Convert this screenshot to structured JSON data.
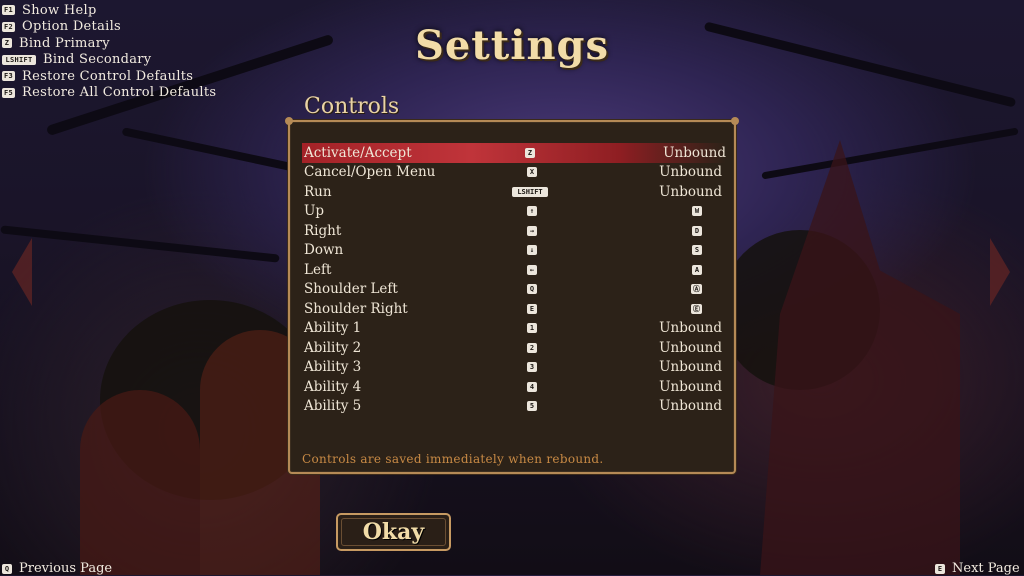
{
  "help": {
    "items": [
      {
        "key": "F1",
        "label": "Show Help"
      },
      {
        "key": "F2",
        "label": "Option Details"
      },
      {
        "key": "Z",
        "label": "Bind Primary"
      },
      {
        "key": "LSHIFT",
        "label": "Bind Secondary"
      },
      {
        "key": "F3",
        "label": "Restore Control Defaults"
      },
      {
        "key": "F5",
        "label": "Restore All Control Defaults"
      }
    ]
  },
  "header": {
    "title": "Settings",
    "section": "Controls"
  },
  "controls": [
    {
      "name": "Activate/Accept",
      "primary": "Z",
      "secondary": "Unbound",
      "selected": true
    },
    {
      "name": "Cancel/Open Menu",
      "primary": "X",
      "secondary": "Unbound"
    },
    {
      "name": "Run",
      "primary": "LSHIFT",
      "secondary": "Unbound"
    },
    {
      "name": "Up",
      "primary": "↑",
      "secondary_key": "W"
    },
    {
      "name": "Right",
      "primary": "→",
      "secondary_key": "D"
    },
    {
      "name": "Down",
      "primary": "↓",
      "secondary_key": "S"
    },
    {
      "name": "Left",
      "primary": "←",
      "secondary_key": "A"
    },
    {
      "name": "Shoulder Left",
      "primary": "Q",
      "secondary_key": "Ⓐ"
    },
    {
      "name": "Shoulder Right",
      "primary": "E",
      "secondary_key": "Ⓔ"
    },
    {
      "name": "Ability 1",
      "primary": "1",
      "secondary": "Unbound"
    },
    {
      "name": "Ability 2",
      "primary": "2",
      "secondary": "Unbound"
    },
    {
      "name": "Ability 3",
      "primary": "3",
      "secondary": "Unbound"
    },
    {
      "name": "Ability 4",
      "primary": "4",
      "secondary": "Unbound"
    },
    {
      "name": "Ability 5",
      "primary": "5",
      "secondary": "Unbound"
    }
  ],
  "footer": {
    "note": "Controls are saved immediately when rebound.",
    "okay_label": "Okay"
  },
  "nav": {
    "prev_key": "Q",
    "prev_label": "Previous Page",
    "next_key": "E",
    "next_label": "Next Page"
  },
  "colors": {
    "selection": "#c0343a",
    "border": "#b58a56",
    "panel": "#2c2218",
    "title": "#f2dca8",
    "note": "#c88a45"
  }
}
